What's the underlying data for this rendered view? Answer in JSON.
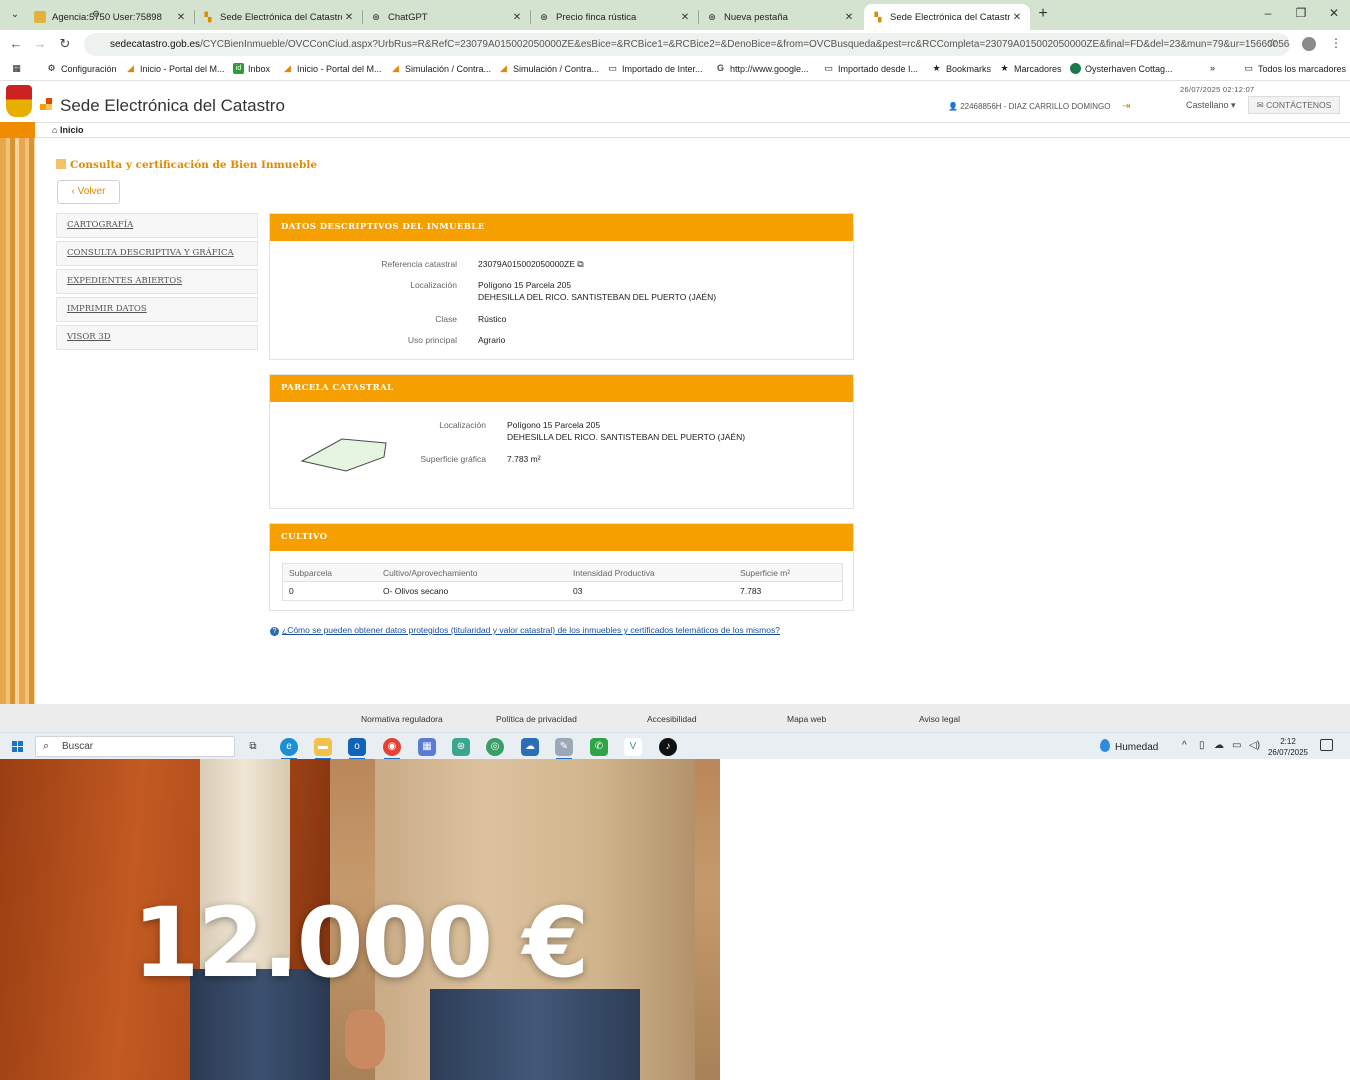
{
  "browser": {
    "tabs": [
      {
        "title": "Agencia:5750 User:75898",
        "active": false
      },
      {
        "title": "Sede Electrónica del Catastro ·",
        "active": false
      },
      {
        "title": "ChatGPT",
        "active": false
      },
      {
        "title": "Precio finca rústica",
        "active": false
      },
      {
        "title": "Nueva pestaña",
        "active": false
      },
      {
        "title": "Sede Electrónica del Catastro ·",
        "active": true
      }
    ],
    "url_host": "sedecatastro.gob.es",
    "url_path": "/CYCBienInmueble/OVCConCiud.aspx?UrbRus=R&RefC=23079A015002050000ZE&esBice=&RCBice1=&RCBice2=&DenoBice=&from=OVCBusqueda&pest=rc&RCCompleta=23079A015002050000ZE&final=FD&del=23&mun=79&ur=156600561",
    "bookmarks": [
      "Configuración",
      "Inicio - Portal del M...",
      "Inbox",
      "Inicio - Portal del M...",
      "Simulación / Contra...",
      "Simulación / Contra...",
      "Importado de Inter...",
      "http://www.google...",
      "Importado desde I...",
      "Bookmarks",
      "Marcadores",
      "Oysterhaven Cottag..."
    ],
    "bookmarks_more": "»",
    "all_bookmarks": "Todos los marcadores"
  },
  "site": {
    "datetime": "26/07/2025  02:12:07",
    "title": "Sede Electrónica del Catastro",
    "user": "22468856H - DIAZ CARRILLO DOMINGO",
    "language": "Castellano ▾",
    "contact": "CONTÁCTENOS",
    "home": "Inicio"
  },
  "main": {
    "heading": "Consulta y certificación de Bien Inmueble",
    "back": "Volver",
    "sidenav": [
      "CARTOGRAFÍA",
      "CONSULTA DESCRIPTIVA Y GRÁFICA",
      "EXPEDIENTES ABIERTOS",
      "IMPRIMIR DATOS",
      "VISOR 3D"
    ],
    "datos": {
      "title": "DATOS DESCRIPTIVOS DEL INMUEBLE",
      "ref_label": "Referencia catastral",
      "ref_value": "23079A015002050000ZE",
      "loc_label": "Localización",
      "loc_line1": "Polígono 15 Parcela 205",
      "loc_line2": "DEHESILLA DEL RICO. SANTISTEBAN DEL PUERTO (JAÉN)",
      "clase_label": "Clase",
      "clase_value": "Rústico",
      "uso_label": "Uso principal",
      "uso_value": "Agrario"
    },
    "parcela": {
      "title": "PARCELA CATASTRAL",
      "loc_label": "Localización",
      "loc_line1": "Polígono 15 Parcela 205",
      "loc_line2": "DEHESILLA DEL RICO. SANTISTEBAN DEL PUERTO (JAÉN)",
      "sup_label": "Superficie gráfica",
      "sup_value": "7.783 m²"
    },
    "cultivo": {
      "title": "CULTIVO",
      "headers": [
        "Subparcela",
        "Cultivo/Aprovechamiento",
        "Intensidad Productiva",
        "Superficie m²"
      ],
      "row": [
        "0",
        "O- Olivos secano",
        "03",
        "7.783"
      ]
    },
    "help": "¿Cómo se pueden obtener datos protegidos (titularidad y valor catastral) de los inmuebles y certificados telemáticos de los mismos?"
  },
  "footer": [
    "Normativa reguladora",
    "Política de privacidad",
    "Accesibilidad",
    "Mapa web",
    "Aviso legal"
  ],
  "taskbar": {
    "search": "Buscar",
    "weather": "Humedad",
    "time": "2:12",
    "date": "26/07/2025"
  },
  "overlay": {
    "price": "12.000 €"
  },
  "colors": {
    "accent": "#f5a000",
    "heading": "#e08a00",
    "link": "#1a4f9c",
    "tabbar": "#d3e3d0"
  }
}
